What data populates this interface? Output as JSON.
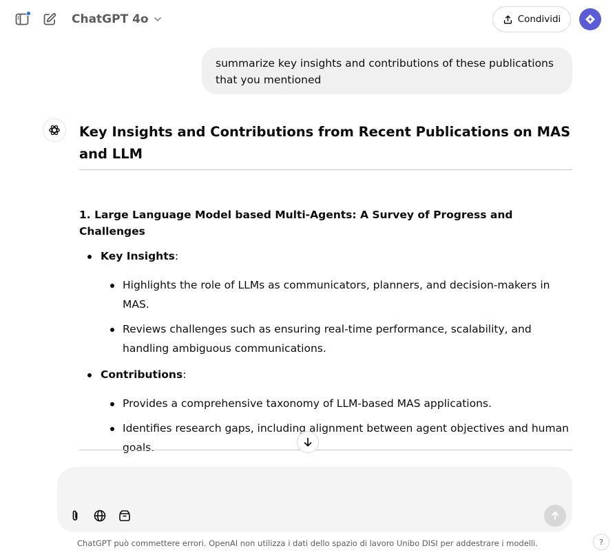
{
  "header": {
    "model_name": "ChatGPT 4o",
    "share_label": "Condividi",
    "icons": {
      "sidebar": "sidebar-toggle-icon",
      "new_chat": "edit-icon",
      "model_menu": "chevron-down-icon",
      "share": "upload-icon",
      "avatar": "user-avatar"
    }
  },
  "user_message": {
    "text": "summarize key insights and contributions of these publications that you mentioned"
  },
  "assistant": {
    "heading": "Key Insights and Contributions from Recent Publications on MAS and LLM",
    "section_title": "1. Large Language Model based Multi-Agents: A Survey of Progress and Challenges",
    "key_insights_label": "Key Insights",
    "key_insights": [
      "Highlights the role of LLMs as communicators, planners, and decision-makers in MAS.",
      "Reviews challenges such as ensuring real-time performance, scalability, and handling ambiguous communications."
    ],
    "contributions_label": "Contributions",
    "contributions": [
      "Provides a comprehensive taxonomy of LLM-based MAS applications.",
      "Identifies research gaps, including alignment between agent objectives and human goals."
    ]
  },
  "composer": {
    "placeholder": "",
    "tools": [
      "paperclip-icon",
      "globe-icon",
      "canvas-icon"
    ],
    "send_icon": "arrow-up-icon"
  },
  "footer": {
    "disclaimer": "ChatGPT può commettere errori. OpenAI non utilizza i dati dello spazio di lavoro Unibo DISI per addestrare i modelli.",
    "help_label": "?"
  },
  "colors": {
    "accent": "#1a73e8",
    "avatar_bg": "#5b5bd6",
    "bubble_bg": "#f0f0f0",
    "composer_bg": "#f4f4f4"
  }
}
